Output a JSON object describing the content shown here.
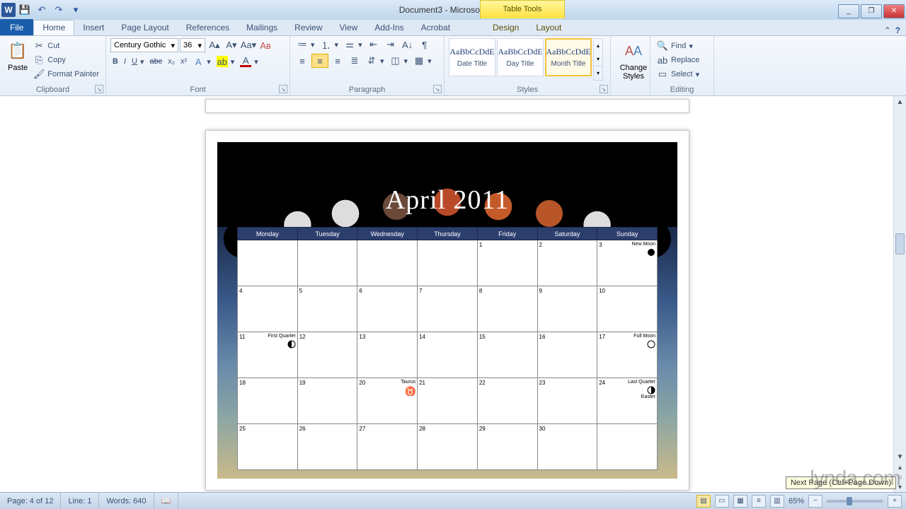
{
  "app": {
    "title": "Document3 - Microsoft Word",
    "contextual_tab_title": "Table Tools"
  },
  "window_controls": {
    "minimize": "_",
    "restore": "❐",
    "close": "✕"
  },
  "qat": {
    "save": "💾",
    "undo": "↶",
    "redo": "↷",
    "customize": "▾"
  },
  "tabs": {
    "file": "File",
    "items": [
      "Home",
      "Insert",
      "Page Layout",
      "References",
      "Mailings",
      "Review",
      "View",
      "Add-Ins",
      "Acrobat"
    ],
    "context_items": [
      "Design",
      "Layout"
    ],
    "active": "Home"
  },
  "ribbon": {
    "clipboard": {
      "label": "Clipboard",
      "paste": "Paste",
      "cut": "Cut",
      "copy": "Copy",
      "format_painter": "Format Painter"
    },
    "font": {
      "label": "Font",
      "name": "Century Gothic",
      "size": "36"
    },
    "paragraph": {
      "label": "Paragraph"
    },
    "styles": {
      "label": "Styles",
      "items": [
        {
          "sample": "AaBbCcDdE",
          "name": "Date Title"
        },
        {
          "sample": "AaBbCcDdE",
          "name": "Day Title"
        },
        {
          "sample": "AaBbCcDdE",
          "name": "Month Title"
        }
      ],
      "selected_index": 2,
      "change_styles": "Change Styles"
    },
    "editing": {
      "label": "Editing",
      "find": "Find",
      "replace": "Replace",
      "select": "Select"
    }
  },
  "document": {
    "calendar_title": "April 2011",
    "day_headers": [
      "Monday",
      "Tuesday",
      "Wednesday",
      "Thursday",
      "Friday",
      "Saturday",
      "Sunday"
    ],
    "weeks": [
      [
        {
          "n": ""
        },
        {
          "n": ""
        },
        {
          "n": ""
        },
        {
          "n": ""
        },
        {
          "n": "1"
        },
        {
          "n": "2"
        },
        {
          "n": "3",
          "event": "New Moon",
          "phase": "new"
        }
      ],
      [
        {
          "n": "4"
        },
        {
          "n": "5"
        },
        {
          "n": "6"
        },
        {
          "n": "7"
        },
        {
          "n": "8"
        },
        {
          "n": "9"
        },
        {
          "n": "10"
        }
      ],
      [
        {
          "n": "11",
          "event": "First Quarter",
          "phase": "first"
        },
        {
          "n": "12"
        },
        {
          "n": "13"
        },
        {
          "n": "14"
        },
        {
          "n": "15"
        },
        {
          "n": "16"
        },
        {
          "n": "17",
          "event": "Full Moon",
          "phase": "full"
        }
      ],
      [
        {
          "n": "18"
        },
        {
          "n": "19"
        },
        {
          "n": "20",
          "event": "Taurus",
          "phase": "taurus"
        },
        {
          "n": "21"
        },
        {
          "n": "22"
        },
        {
          "n": "23"
        },
        {
          "n": "24",
          "event": "Last Quarter",
          "event2": "Easter",
          "phase": "last"
        }
      ],
      [
        {
          "n": "25"
        },
        {
          "n": "26"
        },
        {
          "n": "27"
        },
        {
          "n": "28"
        },
        {
          "n": "29"
        },
        {
          "n": "30"
        },
        {
          "n": ""
        }
      ]
    ]
  },
  "statusbar": {
    "page": "Page: 4 of 12",
    "line": "Line: 1",
    "words": "Words: 640",
    "zoom": "65%"
  },
  "tooltip": "Next Page (Ctrl+Page Down)",
  "watermark": "lynda.com"
}
